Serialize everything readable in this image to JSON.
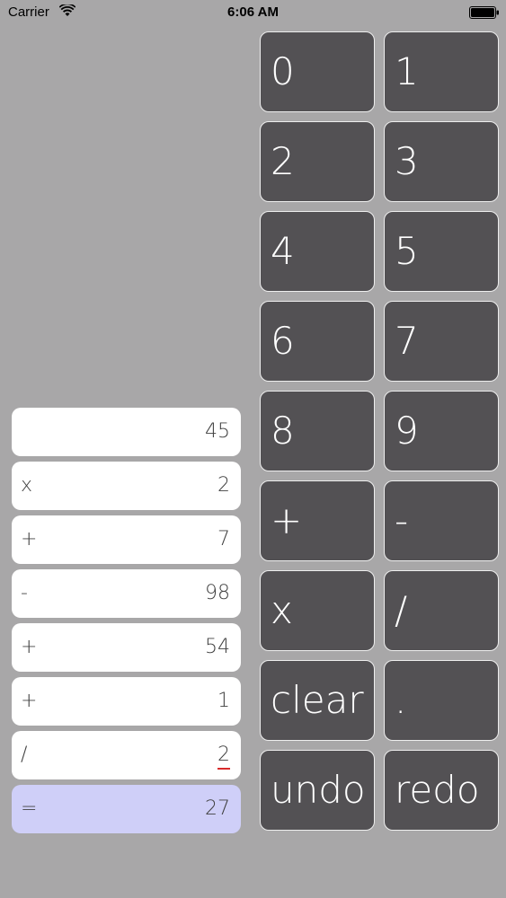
{
  "status_bar": {
    "carrier": "Carrier",
    "time": "6:06 AM"
  },
  "tape": {
    "rows": [
      {
        "op": "",
        "value": "45"
      },
      {
        "op": "x",
        "value": "2"
      },
      {
        "op": "+",
        "value": "7"
      },
      {
        "op": "-",
        "value": "98"
      },
      {
        "op": "+",
        "value": "54"
      },
      {
        "op": "+",
        "value": "1"
      },
      {
        "op": "/",
        "value": "2"
      },
      {
        "op": "=",
        "value": "27"
      }
    ]
  },
  "keypad": {
    "keys": [
      "0",
      "1",
      "2",
      "3",
      "4",
      "5",
      "6",
      "7",
      "8",
      "9",
      "+",
      "-",
      "x",
      "/",
      "clear",
      ".",
      "undo",
      "redo"
    ]
  },
  "colors": {
    "background": "#a8a7a8",
    "key_background": "#535154",
    "result_highlight": "#cfcff8"
  }
}
